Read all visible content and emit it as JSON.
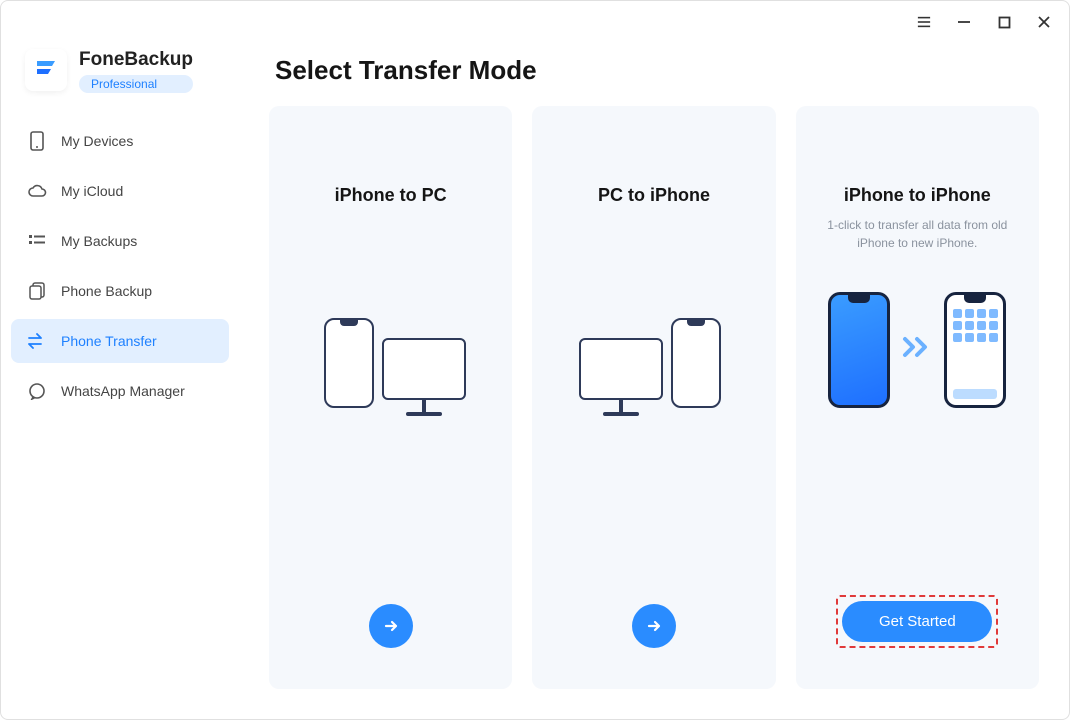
{
  "branding": {
    "app_name": "FoneBackup",
    "badge": "Professional"
  },
  "sidebar": {
    "items": [
      {
        "label": "My Devices"
      },
      {
        "label": "My iCloud"
      },
      {
        "label": "My Backups"
      },
      {
        "label": "Phone Backup"
      },
      {
        "label": "Phone Transfer"
      },
      {
        "label": "WhatsApp Manager"
      }
    ]
  },
  "page": {
    "title": "Select Transfer Mode"
  },
  "cards": [
    {
      "title": "iPhone to PC",
      "desc": "",
      "action_type": "arrow"
    },
    {
      "title": "PC to iPhone",
      "desc": "",
      "action_type": "arrow"
    },
    {
      "title": "iPhone to iPhone",
      "desc": "1-click to transfer all data from old iPhone to new iPhone.",
      "action_type": "button",
      "action_label": "Get Started"
    }
  ]
}
